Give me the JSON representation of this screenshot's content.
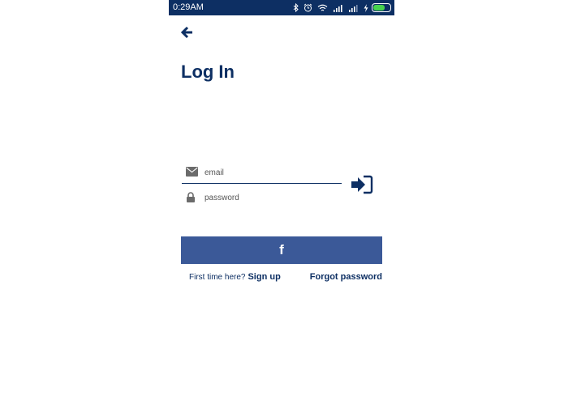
{
  "status_bar": {
    "time": "0:29AM",
    "icons": [
      "bluetooth-icon",
      "alarm-icon",
      "wifi-icon",
      "signal-icon",
      "signal-icon",
      "charging-icon",
      "battery-icon"
    ],
    "battery_level": 0.8,
    "battery_color": "#46d34e"
  },
  "header": {
    "back_icon": "arrow-left-icon",
    "title": "Log In"
  },
  "form": {
    "email_placeholder": "email",
    "password_placeholder": "password",
    "email_icon": "envelope-icon",
    "password_icon": "lock-icon",
    "submit_icon": "sign-in-icon"
  },
  "facebook": {
    "label": "f",
    "color": "#3b5998"
  },
  "footer": {
    "first_time_text": "First time here?",
    "signup_label": "Sign up",
    "forgot_label": "Forgot password"
  },
  "colors": {
    "primary": "#0d2f63",
    "icon_gray": "#6b6b6b"
  }
}
